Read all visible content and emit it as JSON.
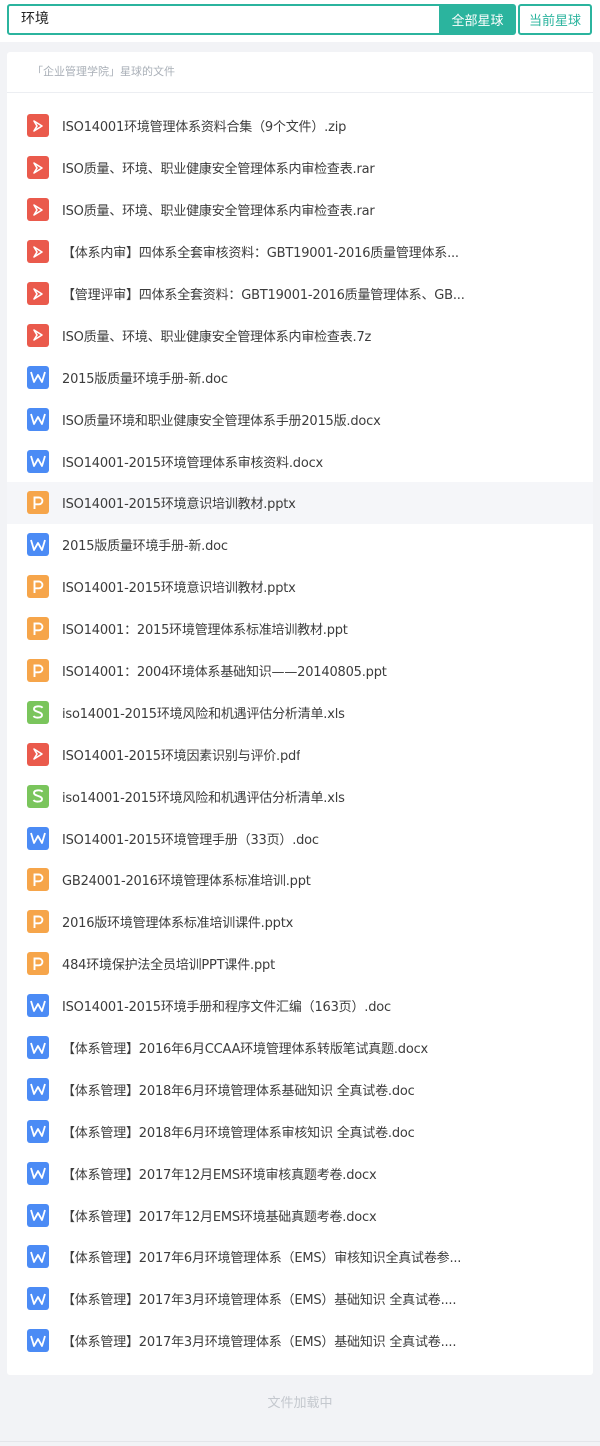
{
  "search": {
    "value": "环境",
    "placeholder": ""
  },
  "buttons": {
    "all_planets": "全部星球",
    "current_planet": "当前星球"
  },
  "header": {
    "title": "「企业管理学院」星球的文件"
  },
  "colors": {
    "accent": "#2bb49e",
    "pdf": "#ea5a4c",
    "word": "#4b8bf5",
    "ppt": "#f6a54a",
    "excel": "#7ac55c"
  },
  "files": [
    {
      "type": "pdf",
      "icon": "pdf-icon",
      "name": "ISO14001环境管理体系资料合集（9个文件）.zip"
    },
    {
      "type": "pdf",
      "icon": "pdf-icon",
      "name": "ISO质量、环境、职业健康安全管理体系内审检查表.rar"
    },
    {
      "type": "pdf",
      "icon": "pdf-icon",
      "name": "ISO质量、环境、职业健康安全管理体系内审检查表.rar"
    },
    {
      "type": "pdf",
      "icon": "pdf-icon",
      "name": "【体系内审】四体系全套审核资料：GBT19001-2016质量管理体系..."
    },
    {
      "type": "pdf",
      "icon": "pdf-icon",
      "name": "【管理评审】四体系全套资料：GBT19001-2016质量管理体系、GB..."
    },
    {
      "type": "pdf",
      "icon": "pdf-icon",
      "name": "ISO质量、环境、职业健康安全管理体系内审检查表.7z"
    },
    {
      "type": "word",
      "icon": "word-icon",
      "name": "2015版质量环境手册-新.doc"
    },
    {
      "type": "word",
      "icon": "word-icon",
      "name": "ISO质量环境和职业健康安全管理体系手册2015版.docx"
    },
    {
      "type": "word",
      "icon": "word-icon",
      "name": "ISO14001-2015环境管理体系审核资料.docx"
    },
    {
      "type": "ppt",
      "icon": "ppt-icon",
      "name": "ISO14001-2015环境意识培训教材.pptx"
    },
    {
      "type": "word",
      "icon": "word-icon",
      "name": "2015版质量环境手册-新.doc"
    },
    {
      "type": "ppt",
      "icon": "ppt-icon",
      "name": "ISO14001-2015环境意识培训教材.pptx"
    },
    {
      "type": "ppt",
      "icon": "ppt-icon",
      "name": "ISO14001：2015环境管理体系标准培训教材.ppt"
    },
    {
      "type": "ppt",
      "icon": "ppt-icon",
      "name": "ISO14001：2004环境体系基础知识——20140805.ppt"
    },
    {
      "type": "excel",
      "icon": "excel-icon",
      "name": "iso14001-2015环境风险和机遇评估分析清单.xls"
    },
    {
      "type": "pdf",
      "icon": "pdf-icon",
      "name": "ISO14001-2015环境因素识别与评价.pdf"
    },
    {
      "type": "excel",
      "icon": "excel-icon",
      "name": "iso14001-2015环境风险和机遇评估分析清单.xls"
    },
    {
      "type": "word",
      "icon": "word-icon",
      "name": "ISO14001-2015环境管理手册（33页）.doc"
    },
    {
      "type": "ppt",
      "icon": "ppt-icon",
      "name": "GB24001-2016环境管理体系标准培训.ppt"
    },
    {
      "type": "ppt",
      "icon": "ppt-icon",
      "name": "2016版环境管理体系标准培训课件.pptx"
    },
    {
      "type": "ppt",
      "icon": "ppt-icon",
      "name": "484环境保护法全员培训PPT课件.ppt"
    },
    {
      "type": "word",
      "icon": "word-icon",
      "name": "ISO14001-2015环境手册和程序文件汇编（163页）.doc"
    },
    {
      "type": "word",
      "icon": "word-icon",
      "name": "【体系管理】2016年6月CCAA环境管理体系转版笔试真题.docx"
    },
    {
      "type": "word",
      "icon": "word-icon",
      "name": "【体系管理】2018年6月环境管理体系基础知识 全真试卷.doc"
    },
    {
      "type": "word",
      "icon": "word-icon",
      "name": "【体系管理】2018年6月环境管理体系审核知识 全真试卷.doc"
    },
    {
      "type": "word",
      "icon": "word-icon",
      "name": "【体系管理】2017年12月EMS环境审核真题考卷.docx"
    },
    {
      "type": "word",
      "icon": "word-icon",
      "name": "【体系管理】2017年12月EMS环境基础真题考卷.docx"
    },
    {
      "type": "word",
      "icon": "word-icon",
      "name": "【体系管理】2017年6月环境管理体系（EMS）审核知识全真试卷参..."
    },
    {
      "type": "word",
      "icon": "word-icon",
      "name": "【体系管理】2017年3月环境管理体系（EMS）基础知识 全真试卷...."
    },
    {
      "type": "word",
      "icon": "word-icon",
      "name": "【体系管理】2017年3月环境管理体系（EMS）基础知识 全真试卷...."
    }
  ],
  "loading_text": "文件加载中"
}
